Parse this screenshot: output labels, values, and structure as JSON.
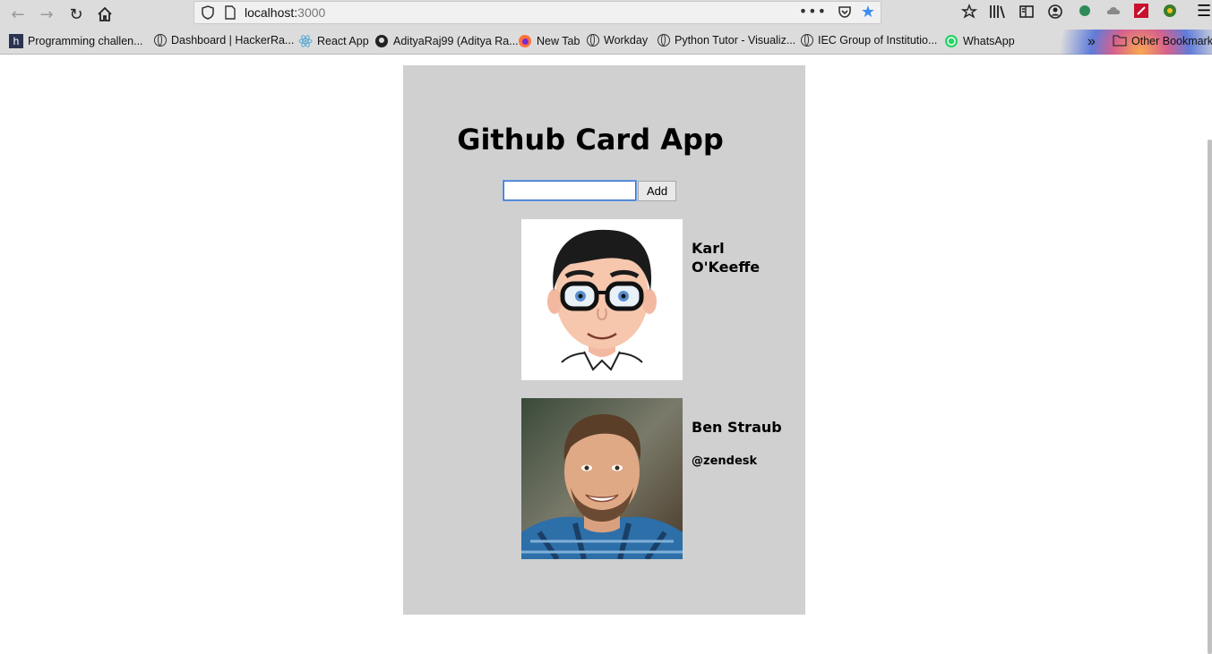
{
  "browser": {
    "url_host": "localhost:",
    "url_port": "3000",
    "bookmarks": [
      "Programming challen...",
      "Dashboard | HackerRa...",
      "React App",
      "AdityaRaj99 (Aditya Ra...",
      "New Tab",
      "Workday",
      "Python Tutor - Visualiz...",
      "IEC Group of Institutio...",
      "WhatsApp"
    ],
    "other_bookmarks": "Other Bookmarks"
  },
  "app": {
    "title": "Github Card App",
    "input_value": "",
    "add_label": "Add",
    "cards": [
      {
        "name": "Karl O'Keeffe",
        "company": ""
      },
      {
        "name": "Ben Straub",
        "company": "@zendesk"
      }
    ]
  }
}
